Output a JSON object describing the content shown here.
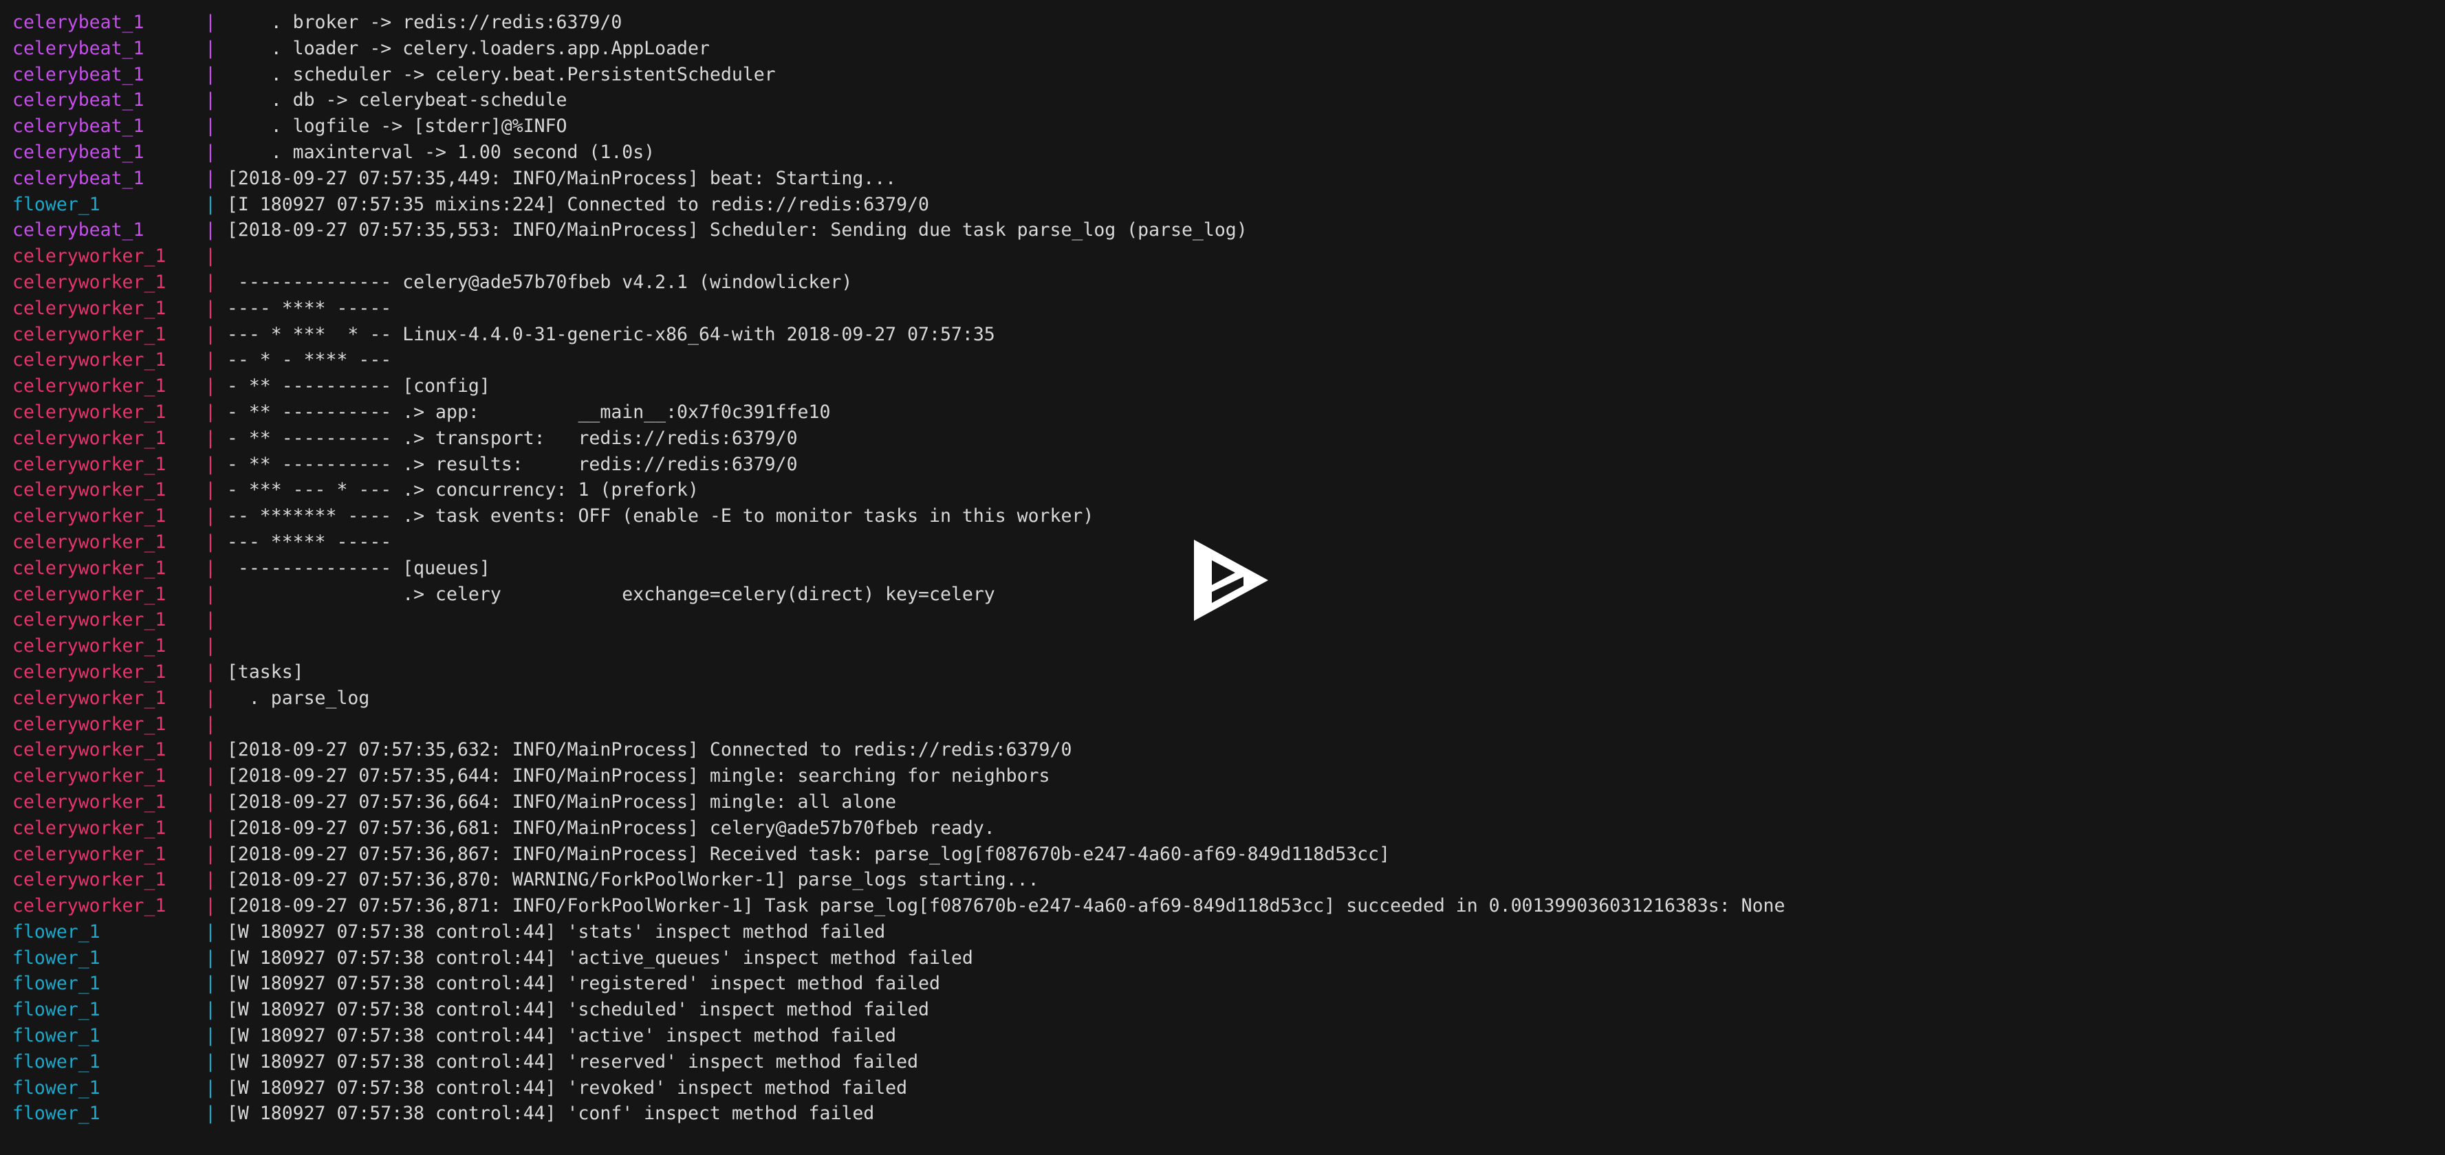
{
  "terminal": {
    "background": "#151515",
    "foreground": "#d8d8d8",
    "service_colors": {
      "celerybeat_1": "#c74ded",
      "celeryworker_1": "#e8336d",
      "flower_1": "#1ba8cb"
    },
    "separator": "|"
  },
  "overlay": {
    "play_button_icon": "asciinema-play-icon",
    "color": "#ffffff"
  },
  "log_lines": [
    {
      "service": "celerybeat_1",
      "message": "    . broker -> redis://redis:6379/0"
    },
    {
      "service": "celerybeat_1",
      "message": "    . loader -> celery.loaders.app.AppLoader"
    },
    {
      "service": "celerybeat_1",
      "message": "    . scheduler -> celery.beat.PersistentScheduler"
    },
    {
      "service": "celerybeat_1",
      "message": "    . db -> celerybeat-schedule"
    },
    {
      "service": "celerybeat_1",
      "message": "    . logfile -> [stderr]@%INFO"
    },
    {
      "service": "celerybeat_1",
      "message": "    . maxinterval -> 1.00 second (1.0s)"
    },
    {
      "service": "celerybeat_1",
      "message": "[2018-09-27 07:57:35,449: INFO/MainProcess] beat: Starting..."
    },
    {
      "service": "flower_1",
      "message": "[I 180927 07:57:35 mixins:224] Connected to redis://redis:6379/0"
    },
    {
      "service": "celerybeat_1",
      "message": "[2018-09-27 07:57:35,553: INFO/MainProcess] Scheduler: Sending due task parse_log (parse_log)"
    },
    {
      "service": "celeryworker_1",
      "message": ""
    },
    {
      "service": "celeryworker_1",
      "message": " -------------- celery@ade57b70fbeb v4.2.1 (windowlicker)"
    },
    {
      "service": "celeryworker_1",
      "message": "---- **** -----"
    },
    {
      "service": "celeryworker_1",
      "message": "--- * ***  * -- Linux-4.4.0-31-generic-x86_64-with 2018-09-27 07:57:35"
    },
    {
      "service": "celeryworker_1",
      "message": "-- * - **** ---"
    },
    {
      "service": "celeryworker_1",
      "message": "- ** ---------- [config]"
    },
    {
      "service": "celeryworker_1",
      "message": "- ** ---------- .> app:         __main__:0x7f0c391ffe10"
    },
    {
      "service": "celeryworker_1",
      "message": "- ** ---------- .> transport:   redis://redis:6379/0"
    },
    {
      "service": "celeryworker_1",
      "message": "- ** ---------- .> results:     redis://redis:6379/0"
    },
    {
      "service": "celeryworker_1",
      "message": "- *** --- * --- .> concurrency: 1 (prefork)"
    },
    {
      "service": "celeryworker_1",
      "message": "-- ******* ---- .> task events: OFF (enable -E to monitor tasks in this worker)"
    },
    {
      "service": "celeryworker_1",
      "message": "--- ***** -----"
    },
    {
      "service": "celeryworker_1",
      "message": " -------------- [queues]"
    },
    {
      "service": "celeryworker_1",
      "message": "                .> celery           exchange=celery(direct) key=celery"
    },
    {
      "service": "celeryworker_1",
      "message": ""
    },
    {
      "service": "celeryworker_1",
      "message": ""
    },
    {
      "service": "celeryworker_1",
      "message": "[tasks]"
    },
    {
      "service": "celeryworker_1",
      "message": "  . parse_log"
    },
    {
      "service": "celeryworker_1",
      "message": ""
    },
    {
      "service": "celeryworker_1",
      "message": "[2018-09-27 07:57:35,632: INFO/MainProcess] Connected to redis://redis:6379/0"
    },
    {
      "service": "celeryworker_1",
      "message": "[2018-09-27 07:57:35,644: INFO/MainProcess] mingle: searching for neighbors"
    },
    {
      "service": "celeryworker_1",
      "message": "[2018-09-27 07:57:36,664: INFO/MainProcess] mingle: all alone"
    },
    {
      "service": "celeryworker_1",
      "message": "[2018-09-27 07:57:36,681: INFO/MainProcess] celery@ade57b70fbeb ready."
    },
    {
      "service": "celeryworker_1",
      "message": "[2018-09-27 07:57:36,867: INFO/MainProcess] Received task: parse_log[f087670b-e247-4a60-af69-849d118d53cc]"
    },
    {
      "service": "celeryworker_1",
      "message": "[2018-09-27 07:57:36,870: WARNING/ForkPoolWorker-1] parse_logs starting..."
    },
    {
      "service": "celeryworker_1",
      "message": "[2018-09-27 07:57:36,871: INFO/ForkPoolWorker-1] Task parse_log[f087670b-e247-4a60-af69-849d118d53cc] succeeded in 0.001399036031216383s: None"
    },
    {
      "service": "flower_1",
      "message": "[W 180927 07:57:38 control:44] 'stats' inspect method failed"
    },
    {
      "service": "flower_1",
      "message": "[W 180927 07:57:38 control:44] 'active_queues' inspect method failed"
    },
    {
      "service": "flower_1",
      "message": "[W 180927 07:57:38 control:44] 'registered' inspect method failed"
    },
    {
      "service": "flower_1",
      "message": "[W 180927 07:57:38 control:44] 'scheduled' inspect method failed"
    },
    {
      "service": "flower_1",
      "message": "[W 180927 07:57:38 control:44] 'active' inspect method failed"
    },
    {
      "service": "flower_1",
      "message": "[W 180927 07:57:38 control:44] 'reserved' inspect method failed"
    },
    {
      "service": "flower_1",
      "message": "[W 180927 07:57:38 control:44] 'revoked' inspect method failed"
    },
    {
      "service": "flower_1",
      "message": "[W 180927 07:57:38 control:44] 'conf' inspect method failed"
    }
  ]
}
